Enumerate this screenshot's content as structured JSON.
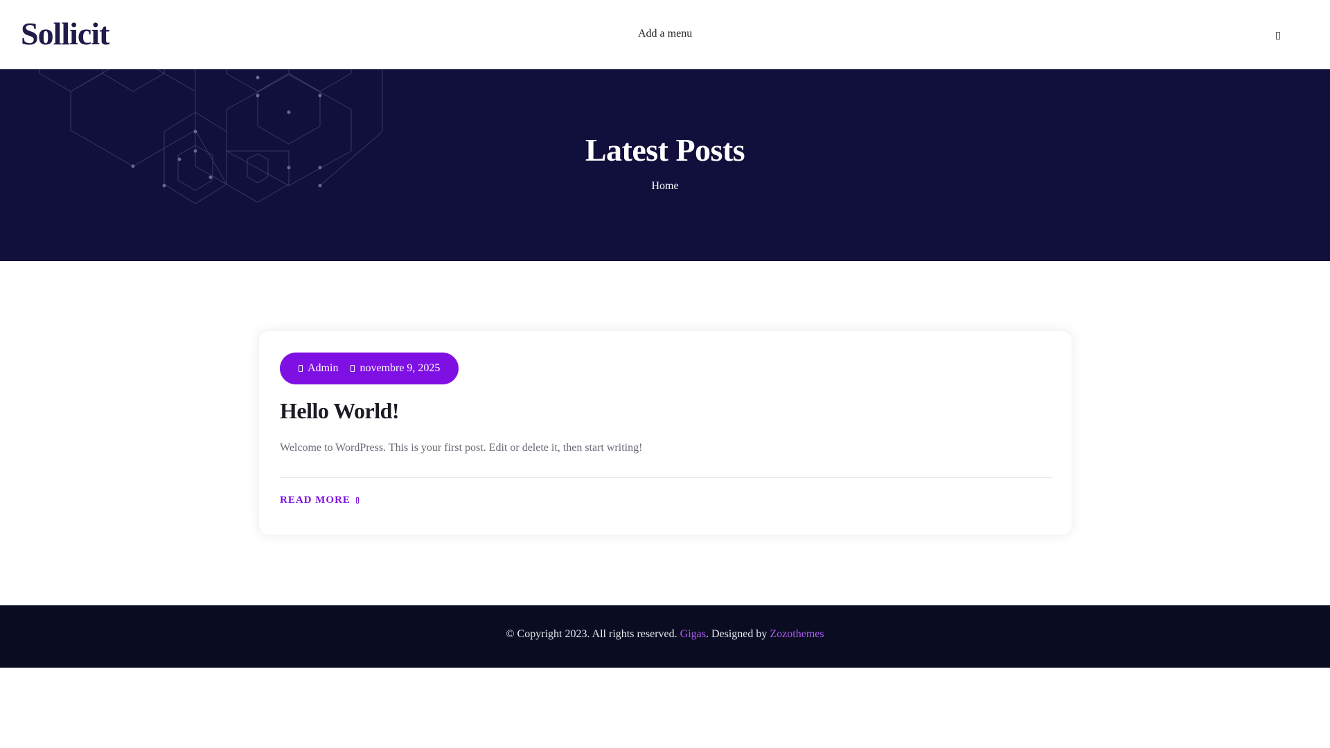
{
  "header": {
    "logo": "Sollicit",
    "menu_label": "Add a menu",
    "search_icon": "search-icon"
  },
  "hero": {
    "title": "Latest Posts",
    "breadcrumb": "Home"
  },
  "post": {
    "author": "Admin",
    "date": "novembre 9, 2025",
    "title": "Hello World!",
    "excerpt": "Welcome to WordPress. This is your first post. Edit or delete it, then start writing!",
    "read_more": "READ MORE",
    "author_icon": "user-icon",
    "date_icon": "calendar-icon",
    "read_more_icon": "arrow-right-icon"
  },
  "footer": {
    "prefix": "© Copyright 2023. All rights reserved. ",
    "link1": "Gigas",
    "middle": ". Designed by ",
    "link2": "Zozothemes"
  },
  "colors": {
    "brand_dark": "#1f1c4a",
    "hero_bg": "#110f3b",
    "accent": "#7f10e3",
    "footer_bg": "#0a0c21",
    "footer_link": "#b15cf6"
  }
}
